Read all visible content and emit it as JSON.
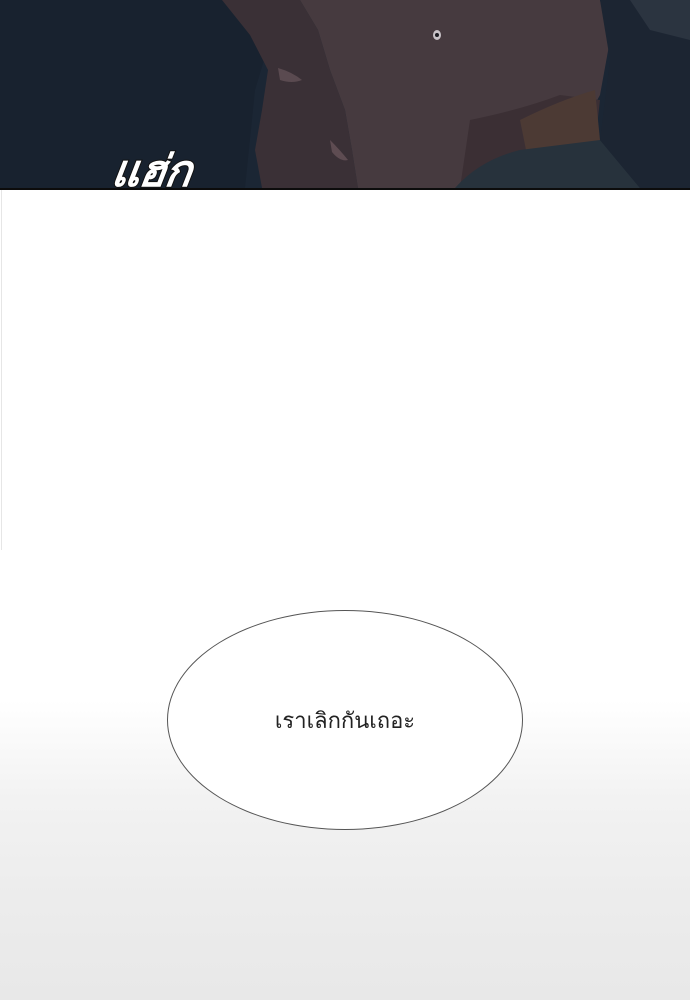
{
  "panel_top": {
    "sound_effect": "แฮ่ก"
  },
  "speech_bubble": {
    "text": "เราเลิกกันเถอะ"
  },
  "colors": {
    "night_background": "#1b2634",
    "skin_shadow": "#3f3337",
    "skin_mid": "#4a3b3f",
    "dark_shirt": "#263238",
    "page_background": "#ffffff",
    "bubble_outline": "#555555"
  }
}
